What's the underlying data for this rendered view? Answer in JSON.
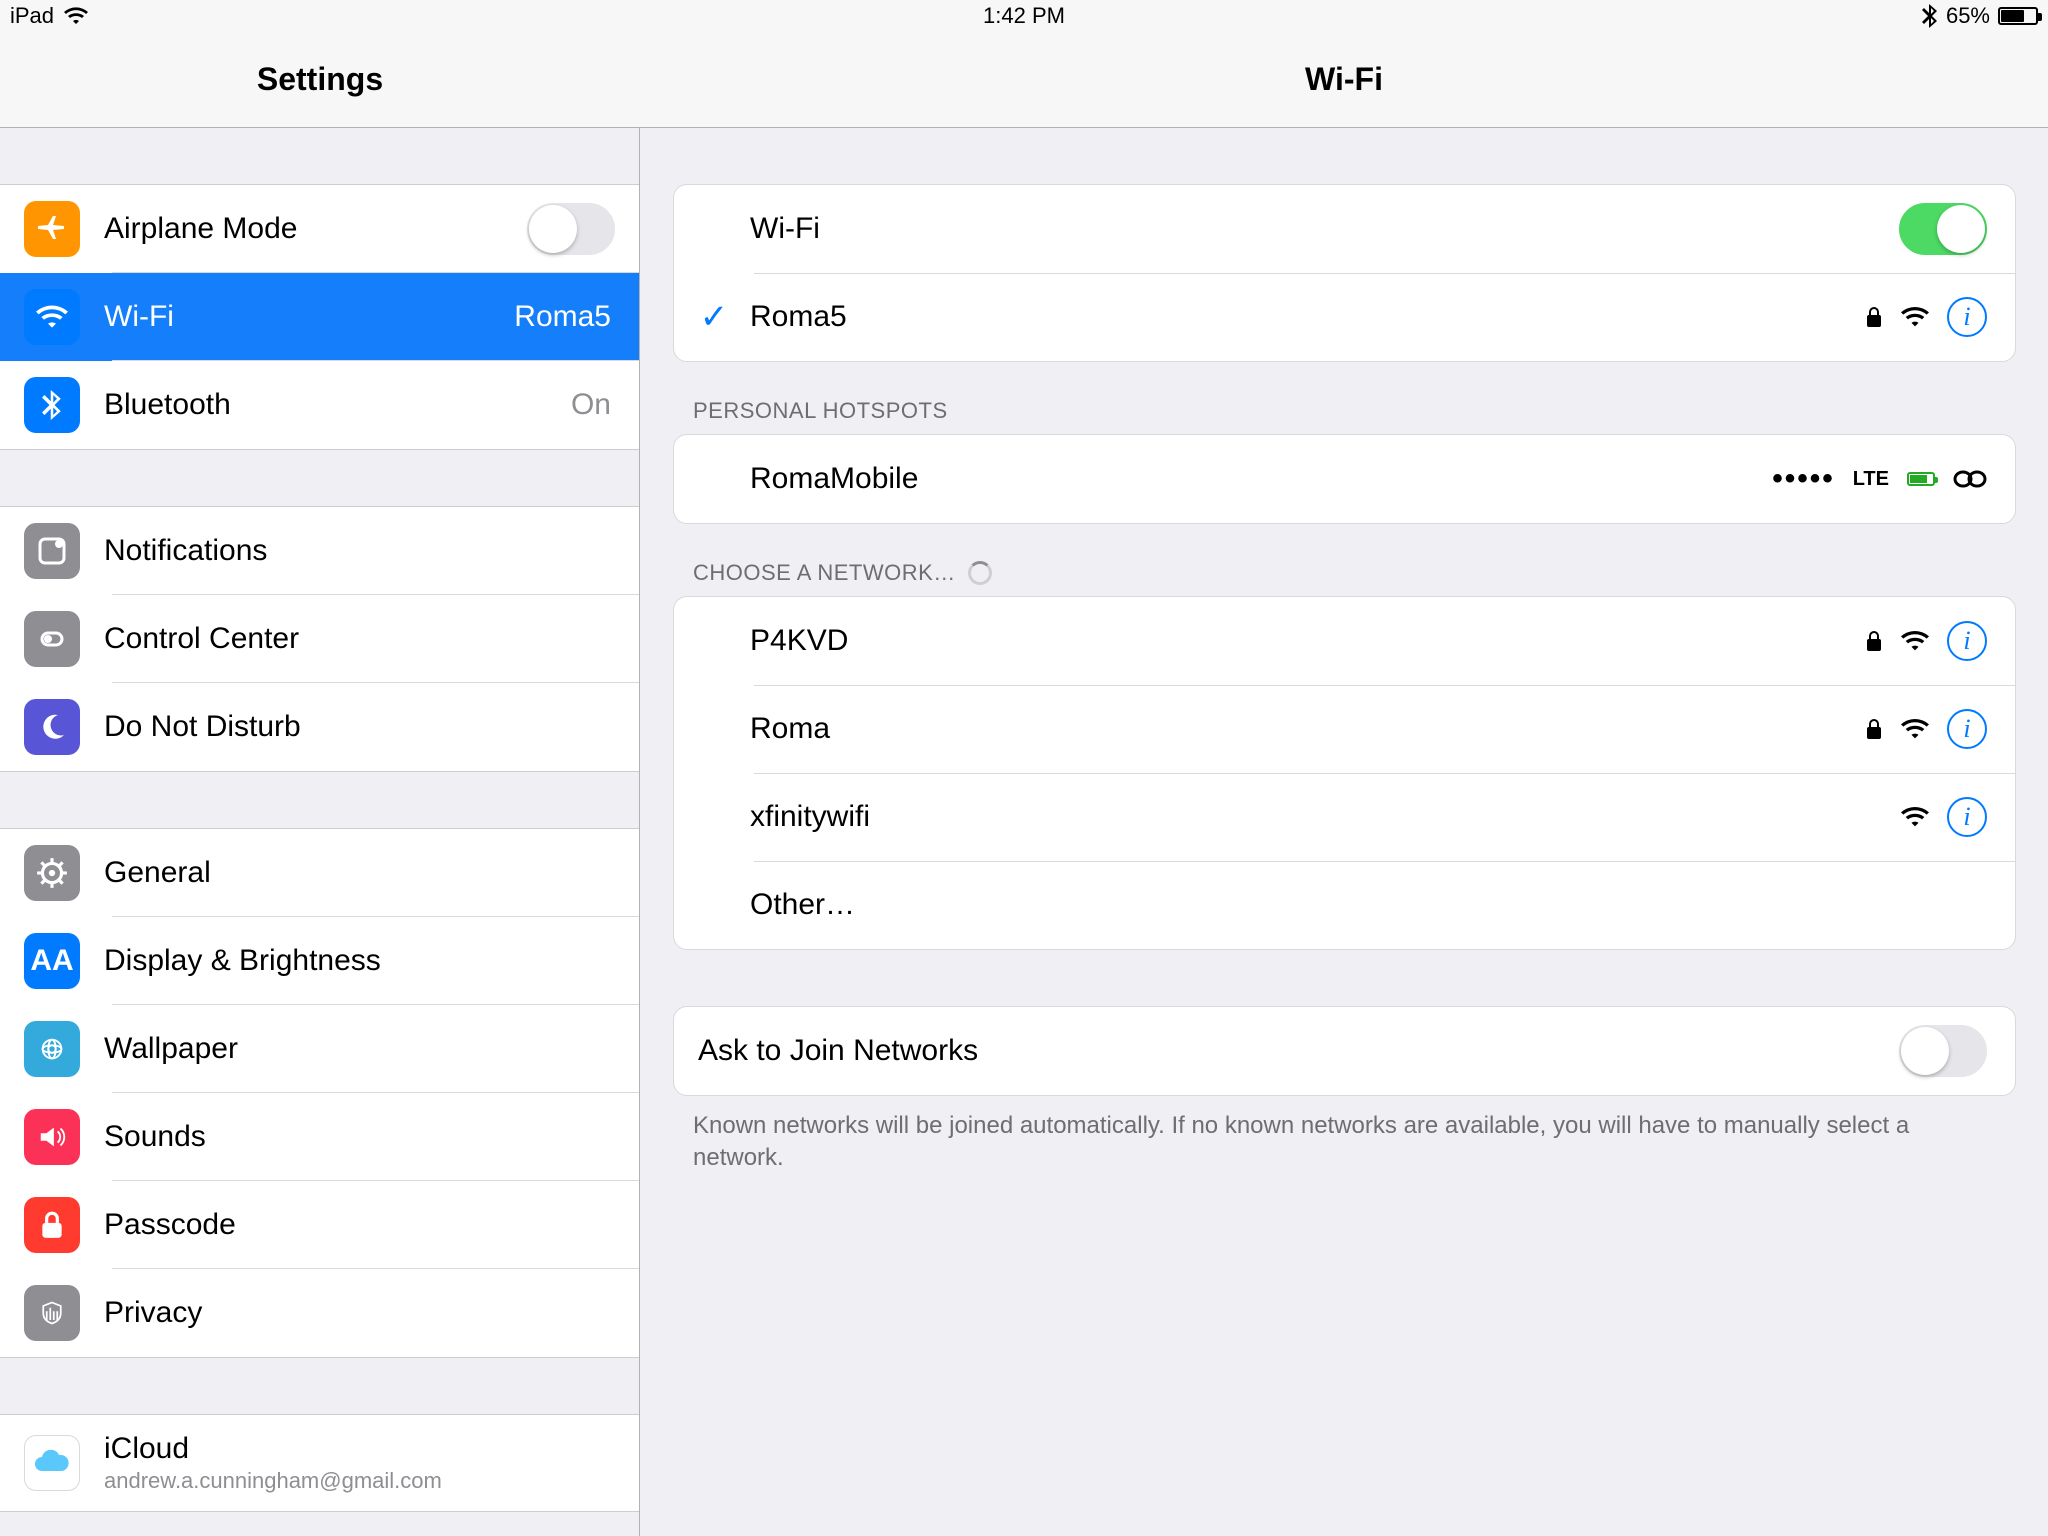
{
  "status": {
    "device": "iPad",
    "time": "1:42 PM",
    "battery_pct": "65%"
  },
  "sidebar": {
    "title": "Settings",
    "groups": [
      [
        {
          "label": "Airplane Mode",
          "value": "",
          "toggle": "off"
        },
        {
          "label": "Wi-Fi",
          "value": "Roma5"
        },
        {
          "label": "Bluetooth",
          "value": "On"
        }
      ],
      [
        {
          "label": "Notifications"
        },
        {
          "label": "Control Center"
        },
        {
          "label": "Do Not Disturb"
        }
      ],
      [
        {
          "label": "General"
        },
        {
          "label": "Display & Brightness"
        },
        {
          "label": "Wallpaper"
        },
        {
          "label": "Sounds"
        },
        {
          "label": "Passcode"
        },
        {
          "label": "Privacy"
        }
      ],
      [
        {
          "label": "iCloud",
          "sub": "andrew.a.cunningham@gmail.com"
        }
      ]
    ]
  },
  "detail": {
    "title": "Wi-Fi",
    "wifi_toggle_label": "Wi-Fi",
    "wifi_toggle_on": true,
    "current_network": "Roma5",
    "hotspots_header": "PERSONAL HOTSPOTS",
    "hotspots": [
      {
        "name": "RomaMobile",
        "signal_dots": "•••••",
        "tech": "LTE"
      }
    ],
    "choose_header": "CHOOSE A NETWORK…",
    "networks": [
      {
        "name": "P4KVD",
        "locked": true,
        "info": true
      },
      {
        "name": "Roma",
        "locked": true,
        "info": true
      },
      {
        "name": "xfinitywifi",
        "locked": false,
        "info": true
      },
      {
        "name": "Other…",
        "locked": false,
        "info": false
      }
    ],
    "ask_label": "Ask to Join Networks",
    "ask_on": false,
    "footer": "Known networks will be joined automatically. If no known networks are available, you will have to manually select a network."
  }
}
